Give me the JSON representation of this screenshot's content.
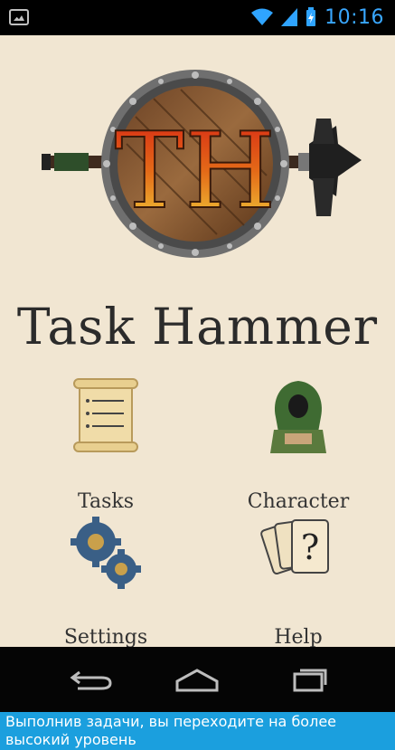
{
  "status": {
    "time": "10:16"
  },
  "app": {
    "title": "Task Hammer",
    "logo_letters": "TH"
  },
  "menu": {
    "tasks": "Tasks",
    "character": "Character",
    "settings": "Settings",
    "help": "Help"
  },
  "nav": {
    "back": "back-icon",
    "home": "home-icon",
    "recent": "recent-apps-icon"
  },
  "caption": {
    "text": "Выполнив задачи, вы переходите на более высокий уровень"
  },
  "colors": {
    "parchment_bg": "#f1e6d2",
    "caption_bg": "#1b9fde",
    "status_accent": "#39a7ff"
  }
}
